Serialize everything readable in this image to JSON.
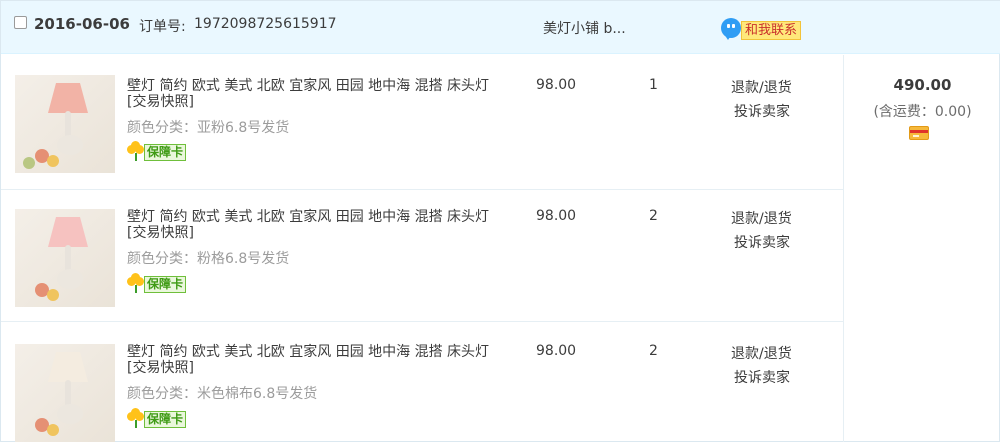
{
  "order": {
    "date": "2016-06-06",
    "order_no_label": "订单号:",
    "order_no": "1972098725615917",
    "shop_name": "美灯小铺 b...",
    "contact_label": "和我联系"
  },
  "items": [
    {
      "title": "壁灯 简约 欧式 美式 北欧 宜家风 田园 地中海 混搭 床头灯 [交易快照]",
      "sku": "颜色分类：亚粉6.8号发货",
      "badge": "保障卡",
      "price": "98.00",
      "qty": "1",
      "refund": "退款/退货",
      "complain": "投诉卖家",
      "shade_color": "#f2b3a6"
    },
    {
      "title": "壁灯 简约 欧式 美式 北欧 宜家风 田园 地中海 混搭 床头灯 [交易快照]",
      "sku": "颜色分类：粉格6.8号发货",
      "badge": "保障卡",
      "price": "98.00",
      "qty": "2",
      "refund": "退款/退货",
      "complain": "投诉卖家",
      "shade_color": "#f6c2c0"
    },
    {
      "title": "壁灯 简约 欧式 美式 北欧 宜家风 田园 地中海 混搭 床头灯 [交易快照]",
      "sku": "颜色分类：米色棉布6.8号发货",
      "badge": "保障卡",
      "price": "98.00",
      "qty": "2",
      "refund": "退款/退货",
      "complain": "投诉卖家",
      "shade_color": "#f4ece0"
    }
  ],
  "summary": {
    "total": "490.00",
    "shipping": "(含运费：0.00)"
  },
  "icons": {
    "checkbox": "checkbox-icon",
    "contact": "chat-bubble-icon",
    "badge": "flower-icon",
    "payment": "credit-card-icon"
  }
}
